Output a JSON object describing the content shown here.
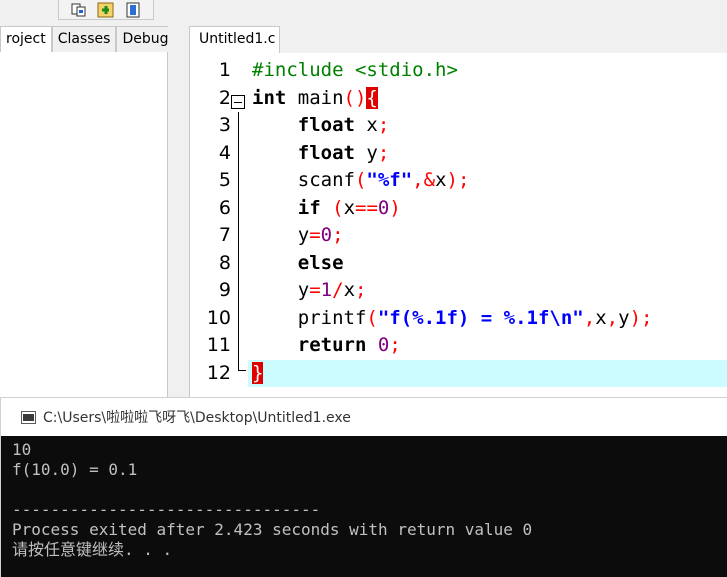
{
  "toolbar": {
    "buttons": [
      "step-over-icon",
      "add-watch-icon",
      "view-cpu-icon"
    ]
  },
  "left_tabs": [
    "roject",
    "Classes",
    "Debug"
  ],
  "editor": {
    "tab_title": "Untitled1.c",
    "line_numbers": [
      "1",
      "2",
      "3",
      "4",
      "5",
      "6",
      "7",
      "8",
      "9",
      "10",
      "11",
      "12"
    ],
    "current_line": 12
  },
  "console": {
    "title": "C:\\Users\\啦啦啦飞呀飞\\Desktop\\Untitled1.exe",
    "lines": [
      "10",
      "f(10.0) = 0.1",
      "",
      "--------------------------------",
      "Process exited after 2.423 seconds with return value 0",
      "请按任意键继续. . ."
    ]
  },
  "colors": {
    "preprocessor": "#008000",
    "string": "#0000ff",
    "number": "#800080",
    "symbol": "#ff0000",
    "current_line": "#ccfcff",
    "console_bg": "#0c0c0c",
    "console_fg": "#c0c0c0"
  }
}
